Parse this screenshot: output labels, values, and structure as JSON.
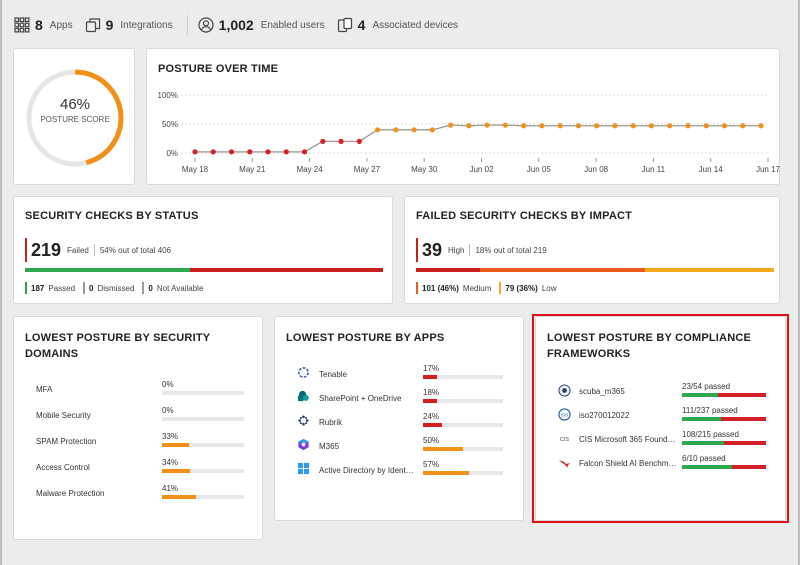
{
  "summary": {
    "apps": {
      "count": "8",
      "label": "Apps",
      "icon": "grid-icon"
    },
    "integrations": {
      "count": "9",
      "label": "Integrations",
      "icon": "integrations-icon"
    },
    "users": {
      "count": "1,002",
      "label": "Enabled users",
      "icon": "user-icon"
    },
    "devices": {
      "count": "4",
      "label": "Associated devices",
      "icon": "devices-icon"
    }
  },
  "posture_score": {
    "value": "46%",
    "label": "POSTURE SCORE",
    "fraction": 0.46,
    "color": "#f39019"
  },
  "posture_over_time": {
    "title": "POSTURE OVER TIME",
    "chart_data": {
      "type": "line",
      "y_ticks": [
        "100%",
        "50%",
        "0%"
      ],
      "ylim": [
        0,
        100
      ],
      "x_ticks": [
        "May 18",
        "May 21",
        "May 24",
        "May 27",
        "May 30",
        "Jun 02",
        "Jun 05",
        "Jun 08",
        "Jun 11",
        "Jun 14",
        "Jun 17"
      ],
      "values": [
        2,
        2,
        2,
        2,
        2,
        2,
        2,
        20,
        20,
        20,
        40,
        40,
        40,
        40,
        48,
        47,
        48,
        48,
        47,
        47,
        47,
        47,
        47,
        47,
        47,
        47,
        47,
        47,
        47,
        47,
        47,
        47
      ],
      "colors": {
        "low": "#d62027",
        "mid": "#f39019",
        "line": "#999999"
      }
    }
  },
  "security_checks_by_status": {
    "title": "SECURITY CHECKS BY STATUS",
    "count": "219",
    "level": "Failed",
    "share": "54%",
    "share_text": "out of total",
    "total": "406",
    "segments": [
      {
        "name": "Passed",
        "fraction": 0.46,
        "color": "#2fa84f"
      },
      {
        "name": "Failed",
        "fraction": 0.54,
        "color": "#c8201e"
      }
    ],
    "legend": [
      {
        "value": "187",
        "label": "Passed",
        "color": "#2fa84f"
      },
      {
        "value": "0",
        "label": "Dismissed",
        "color": "#999999"
      },
      {
        "value": "0",
        "label": "Not Available",
        "color": "#999999"
      }
    ]
  },
  "failed_checks_by_impact": {
    "title": "FAILED SECURITY CHECKS BY IMPACT",
    "count": "39",
    "level": "High",
    "share": "18%",
    "share_text": "out of total",
    "total": "219",
    "segments": [
      {
        "name": "High",
        "fraction": 0.18,
        "color": "#c8201e"
      },
      {
        "name": "Medium",
        "fraction": 0.46,
        "color": "#ea5b1c"
      },
      {
        "name": "Low",
        "fraction": 0.36,
        "color": "#f2a91e"
      }
    ],
    "legend": [
      {
        "value": "101 (46%)",
        "label": "Medium",
        "color": "#ea5b1c"
      },
      {
        "value": "79 (36%)",
        "label": "Low",
        "color": "#f2a91e"
      }
    ]
  },
  "lowest_by_domains": {
    "title": "LOWEST POSTURE BY SECURITY DOMAINS",
    "items": [
      {
        "label": "MFA",
        "pct": "0%",
        "value": 0
      },
      {
        "label": "Mobile Security",
        "pct": "0%",
        "value": 0
      },
      {
        "label": "SPAM Protection",
        "pct": "33%",
        "value": 33
      },
      {
        "label": "Access Control",
        "pct": "34%",
        "value": 34
      },
      {
        "label": "Malware Protection",
        "pct": "41%",
        "value": 41
      }
    ]
  },
  "lowest_by_apps": {
    "title": "LOWEST POSTURE BY APPS",
    "items": [
      {
        "label": "Tenable",
        "pct": "17%",
        "value": 17,
        "icon": "tenable-icon"
      },
      {
        "label": "SharePoint + OneDrive",
        "pct": "18%",
        "value": 18,
        "icon": "sharepoint-icon"
      },
      {
        "label": "Rubrik",
        "pct": "24%",
        "value": 24,
        "icon": "rubrik-icon"
      },
      {
        "label": "M365",
        "pct": "50%",
        "value": 50,
        "icon": "m365-icon"
      },
      {
        "label": "Active Directory by Ident…",
        "pct": "57%",
        "value": 57,
        "icon": "windows-icon"
      }
    ]
  },
  "lowest_by_frameworks": {
    "title": "LOWEST POSTURE BY COMPLIANCE FRAMEWORKS",
    "items": [
      {
        "label": "scuba_m365",
        "passed": "23/54 passed",
        "fraction": 0.43,
        "icon": "scuba-icon"
      },
      {
        "label": "iso270012022",
        "passed": "111/237 passed",
        "fraction": 0.47,
        "icon": "iso-icon"
      },
      {
        "label": "CIS Microsoft 365 Found…",
        "passed": "108/215 passed",
        "fraction": 0.5,
        "icon": "cis-icon"
      },
      {
        "label": "Falcon Shield AI Benchm…",
        "passed": "6/10 passed",
        "fraction": 0.6,
        "icon": "falcon-icon"
      }
    ]
  },
  "colors": {
    "orange": "#f39019",
    "red": "#d62027",
    "green": "#2fa84f",
    "highlight": "#e0111a"
  }
}
